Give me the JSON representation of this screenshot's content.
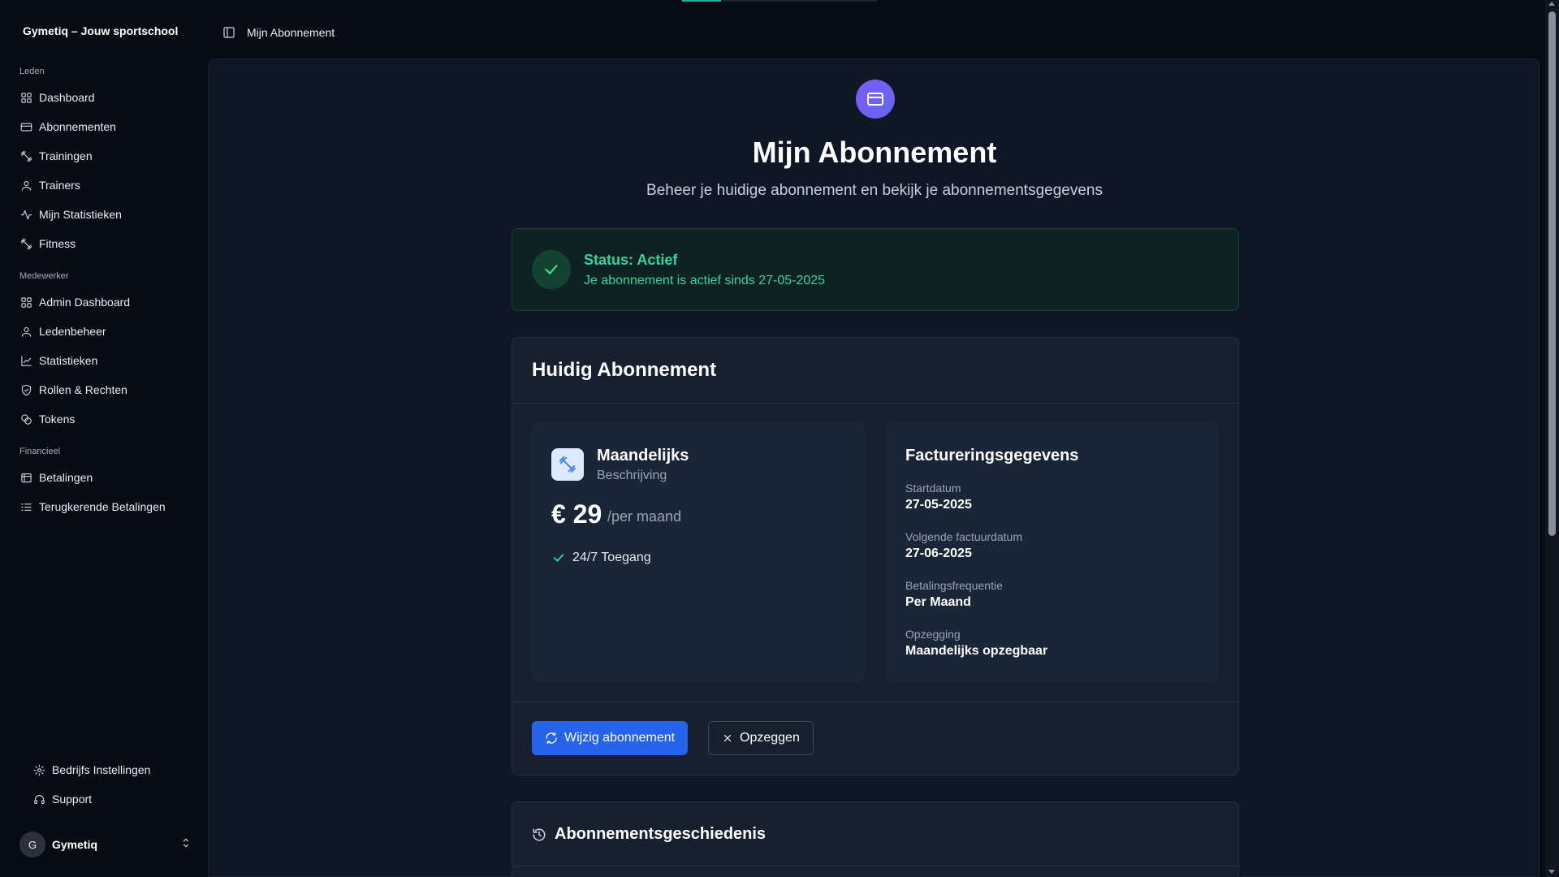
{
  "app": {
    "brand": "Gymetiq – Jouw sportschool"
  },
  "top_progress": {
    "value": 0.2
  },
  "sidebar": {
    "groups": [
      {
        "label": "Leden",
        "items": [
          {
            "label": "Dashboard",
            "icon": "grid-icon"
          },
          {
            "label": "Abonnementen",
            "icon": "credit-card-icon"
          },
          {
            "label": "Trainingen",
            "icon": "dumbbell-icon"
          },
          {
            "label": "Trainers",
            "icon": "user-icon"
          },
          {
            "label": "Mijn Statistieken",
            "icon": "activity-icon"
          },
          {
            "label": "Fitness",
            "icon": "dumbbell-icon"
          }
        ]
      },
      {
        "label": "Medewerker",
        "items": [
          {
            "label": "Admin Dashboard",
            "icon": "grid-icon"
          },
          {
            "label": "Ledenbeheer",
            "icon": "user-icon"
          },
          {
            "label": "Statistieken",
            "icon": "chart-icon"
          },
          {
            "label": "Rollen & Rechten",
            "icon": "shield-icon"
          },
          {
            "label": "Tokens",
            "icon": "coins-icon"
          }
        ]
      },
      {
        "label": "Financieel",
        "items": [
          {
            "label": "Betalingen",
            "icon": "wallet-icon"
          },
          {
            "label": "Terugkerende Betalingen",
            "icon": "list-icon"
          }
        ]
      }
    ],
    "bottom": [
      {
        "label": "Bedrijfs Instellingen",
        "icon": "gear-icon"
      },
      {
        "label": "Support",
        "icon": "headset-icon"
      }
    ],
    "user": {
      "initial": "G",
      "name": "Gymetiq"
    }
  },
  "header": {
    "breadcrumb": "Mijn Abonnement"
  },
  "page": {
    "title": "Mijn Abonnement",
    "subtitle": "Beheer je huidige abonnement en bekijk je abonnementsgegevens"
  },
  "status": {
    "title": "Status: Actief",
    "text": "Je abonnement is actief sinds 27-05-2025",
    "color": "#34d399"
  },
  "subscription": {
    "title": "Huidig Abonnement",
    "plan": {
      "name": "Maandelijks",
      "description": "Beschrijving",
      "price": "€ 29",
      "period": "/per maand",
      "features": [
        "24/7 Toegang"
      ]
    },
    "billing": {
      "title": "Factureringsgegevens",
      "fields": [
        {
          "label": "Startdatum",
          "value": "27-05-2025"
        },
        {
          "label": "Volgende factuurdatum",
          "value": "27-06-2025"
        },
        {
          "label": "Betalingsfrequentie",
          "value": "Per Maand"
        },
        {
          "label": "Opzegging",
          "value": "Maandelijks opzegbaar"
        }
      ]
    },
    "actions": {
      "change": "Wijzig abonnement",
      "cancel": "Opzeggen"
    }
  },
  "history": {
    "title": "Abonnementsgeschiedenis"
  },
  "colors": {
    "accent": "#2563eb",
    "hero": "#6d5cf6",
    "success": "#34d399"
  }
}
